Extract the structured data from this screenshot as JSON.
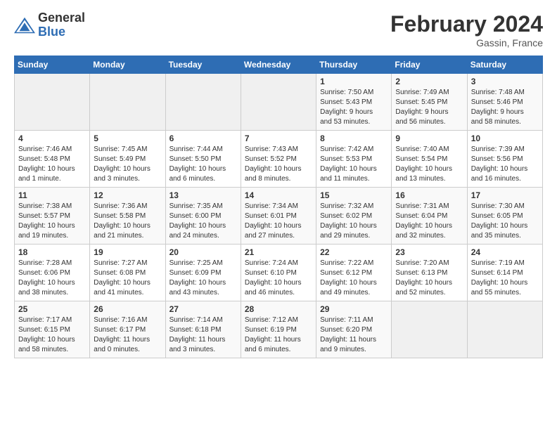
{
  "logo": {
    "general": "General",
    "blue": "Blue"
  },
  "title": {
    "month": "February 2024",
    "location": "Gassin, France"
  },
  "days_of_week": [
    "Sunday",
    "Monday",
    "Tuesday",
    "Wednesday",
    "Thursday",
    "Friday",
    "Saturday"
  ],
  "weeks": [
    [
      {
        "day": "",
        "info": ""
      },
      {
        "day": "",
        "info": ""
      },
      {
        "day": "",
        "info": ""
      },
      {
        "day": "",
        "info": ""
      },
      {
        "day": "1",
        "info": "Sunrise: 7:50 AM\nSunset: 5:43 PM\nDaylight: 9 hours\nand 53 minutes."
      },
      {
        "day": "2",
        "info": "Sunrise: 7:49 AM\nSunset: 5:45 PM\nDaylight: 9 hours\nand 56 minutes."
      },
      {
        "day": "3",
        "info": "Sunrise: 7:48 AM\nSunset: 5:46 PM\nDaylight: 9 hours\nand 58 minutes."
      }
    ],
    [
      {
        "day": "4",
        "info": "Sunrise: 7:46 AM\nSunset: 5:48 PM\nDaylight: 10 hours\nand 1 minute."
      },
      {
        "day": "5",
        "info": "Sunrise: 7:45 AM\nSunset: 5:49 PM\nDaylight: 10 hours\nand 3 minutes."
      },
      {
        "day": "6",
        "info": "Sunrise: 7:44 AM\nSunset: 5:50 PM\nDaylight: 10 hours\nand 6 minutes."
      },
      {
        "day": "7",
        "info": "Sunrise: 7:43 AM\nSunset: 5:52 PM\nDaylight: 10 hours\nand 8 minutes."
      },
      {
        "day": "8",
        "info": "Sunrise: 7:42 AM\nSunset: 5:53 PM\nDaylight: 10 hours\nand 11 minutes."
      },
      {
        "day": "9",
        "info": "Sunrise: 7:40 AM\nSunset: 5:54 PM\nDaylight: 10 hours\nand 13 minutes."
      },
      {
        "day": "10",
        "info": "Sunrise: 7:39 AM\nSunset: 5:56 PM\nDaylight: 10 hours\nand 16 minutes."
      }
    ],
    [
      {
        "day": "11",
        "info": "Sunrise: 7:38 AM\nSunset: 5:57 PM\nDaylight: 10 hours\nand 19 minutes."
      },
      {
        "day": "12",
        "info": "Sunrise: 7:36 AM\nSunset: 5:58 PM\nDaylight: 10 hours\nand 21 minutes."
      },
      {
        "day": "13",
        "info": "Sunrise: 7:35 AM\nSunset: 6:00 PM\nDaylight: 10 hours\nand 24 minutes."
      },
      {
        "day": "14",
        "info": "Sunrise: 7:34 AM\nSunset: 6:01 PM\nDaylight: 10 hours\nand 27 minutes."
      },
      {
        "day": "15",
        "info": "Sunrise: 7:32 AM\nSunset: 6:02 PM\nDaylight: 10 hours\nand 29 minutes."
      },
      {
        "day": "16",
        "info": "Sunrise: 7:31 AM\nSunset: 6:04 PM\nDaylight: 10 hours\nand 32 minutes."
      },
      {
        "day": "17",
        "info": "Sunrise: 7:30 AM\nSunset: 6:05 PM\nDaylight: 10 hours\nand 35 minutes."
      }
    ],
    [
      {
        "day": "18",
        "info": "Sunrise: 7:28 AM\nSunset: 6:06 PM\nDaylight: 10 hours\nand 38 minutes."
      },
      {
        "day": "19",
        "info": "Sunrise: 7:27 AM\nSunset: 6:08 PM\nDaylight: 10 hours\nand 41 minutes."
      },
      {
        "day": "20",
        "info": "Sunrise: 7:25 AM\nSunset: 6:09 PM\nDaylight: 10 hours\nand 43 minutes."
      },
      {
        "day": "21",
        "info": "Sunrise: 7:24 AM\nSunset: 6:10 PM\nDaylight: 10 hours\nand 46 minutes."
      },
      {
        "day": "22",
        "info": "Sunrise: 7:22 AM\nSunset: 6:12 PM\nDaylight: 10 hours\nand 49 minutes."
      },
      {
        "day": "23",
        "info": "Sunrise: 7:20 AM\nSunset: 6:13 PM\nDaylight: 10 hours\nand 52 minutes."
      },
      {
        "day": "24",
        "info": "Sunrise: 7:19 AM\nSunset: 6:14 PM\nDaylight: 10 hours\nand 55 minutes."
      }
    ],
    [
      {
        "day": "25",
        "info": "Sunrise: 7:17 AM\nSunset: 6:15 PM\nDaylight: 10 hours\nand 58 minutes."
      },
      {
        "day": "26",
        "info": "Sunrise: 7:16 AM\nSunset: 6:17 PM\nDaylight: 11 hours\nand 0 minutes."
      },
      {
        "day": "27",
        "info": "Sunrise: 7:14 AM\nSunset: 6:18 PM\nDaylight: 11 hours\nand 3 minutes."
      },
      {
        "day": "28",
        "info": "Sunrise: 7:12 AM\nSunset: 6:19 PM\nDaylight: 11 hours\nand 6 minutes."
      },
      {
        "day": "29",
        "info": "Sunrise: 7:11 AM\nSunset: 6:20 PM\nDaylight: 11 hours\nand 9 minutes."
      },
      {
        "day": "",
        "info": ""
      },
      {
        "day": "",
        "info": ""
      }
    ]
  ]
}
